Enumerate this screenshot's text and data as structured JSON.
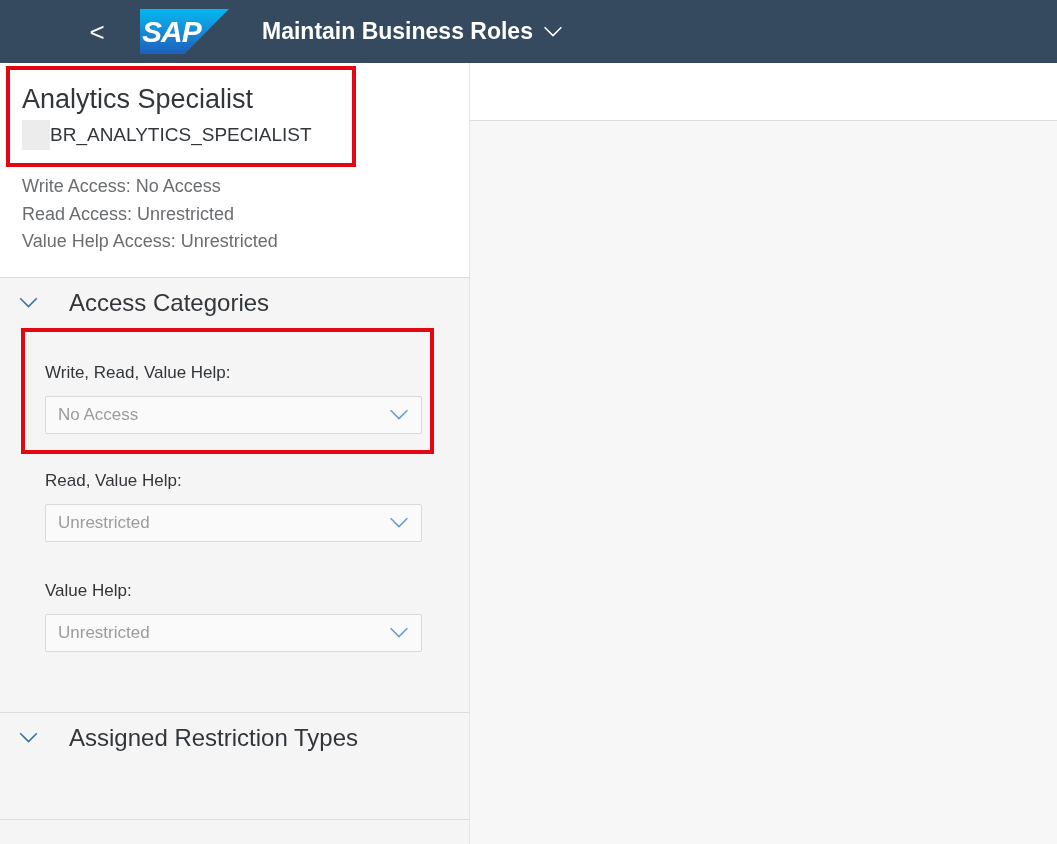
{
  "shell_bar": {
    "back": "<",
    "logo": "SAP",
    "title": "Maintain Business Roles"
  },
  "role": {
    "name": "Analytics Specialist",
    "id": "BR_ANALYTICS_SPECIALIST",
    "highlighted": true,
    "access": [
      "Write Access: No Access",
      "Read Access: Unrestricted",
      "Value Help Access: Unrestricted"
    ]
  },
  "sections": [
    {
      "title": "Access Categories",
      "expanded": true,
      "fields": [
        {
          "label": "Write, Read, Value Help:",
          "value": "No Access",
          "disabled": true,
          "highlighted": true
        },
        {
          "label": "Read, Value Help:",
          "value": "Unrestricted",
          "disabled": true,
          "highlighted": false
        },
        {
          "label": "Value Help:",
          "value": "Unrestricted",
          "disabled": true,
          "highlighted": false
        }
      ]
    },
    {
      "title": "Assigned Restriction Types",
      "expanded": true
    }
  ]
}
